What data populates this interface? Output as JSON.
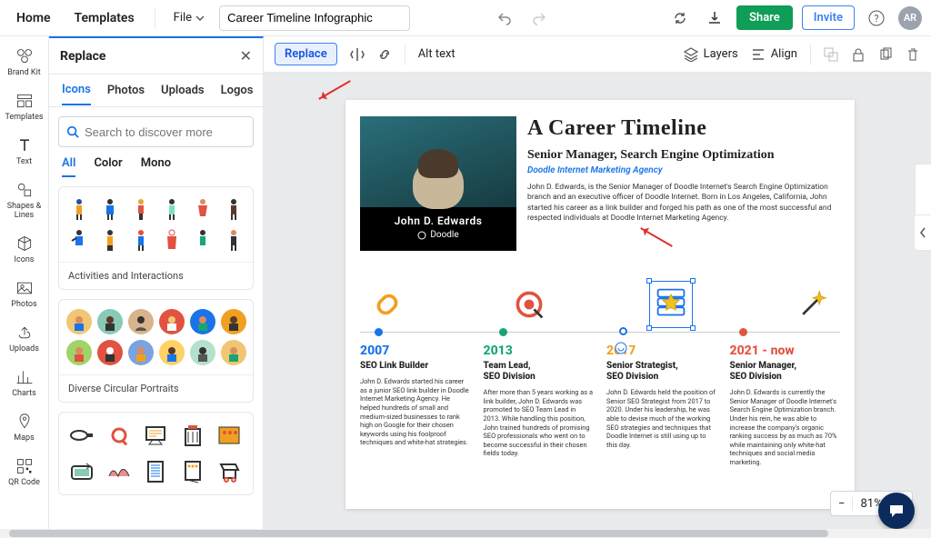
{
  "topbar": {
    "home": "Home",
    "templates": "Templates",
    "file": "File",
    "title_value": "Career Timeline Infographic",
    "share": "Share",
    "invite": "Invite",
    "avatar": "AR"
  },
  "rail": {
    "items": [
      {
        "label": "Brand Kit"
      },
      {
        "label": "Templates"
      },
      {
        "label": "Text"
      },
      {
        "label": "Shapes & Lines"
      },
      {
        "label": "Icons"
      },
      {
        "label": "Photos"
      },
      {
        "label": "Uploads"
      },
      {
        "label": "Charts"
      },
      {
        "label": "Maps"
      },
      {
        "label": "QR Code"
      }
    ]
  },
  "panel": {
    "title": "Replace",
    "tabs": [
      "Icons",
      "Photos",
      "Uploads",
      "Logos"
    ],
    "search_placeholder": "Search to discover more",
    "filters": [
      "All",
      "Color",
      "Mono"
    ],
    "card1_caption": "Activities and Interactions",
    "card2_caption": "Diverse Circular Portraits"
  },
  "ctx": {
    "replace": "Replace",
    "alt_text": "Alt text",
    "layers": "Layers",
    "align": "Align"
  },
  "doc": {
    "title": "A Career Timeline",
    "role": "Senior Manager, Search Engine Optimization",
    "agency": "Doodle Internet Marketing Agency",
    "bio": "John D. Edwards, is the Senior Manager of Doodle Internet's Search Engine Optimization branch and an executive officer of Doodle Internet. Born in Los Angeles, California, John started his career as a link builder and forged his path as one of the most successful and respected individuals at Doodle Internet Marketing Agency.",
    "profile_name": "John D. Edwards",
    "profile_company": "Doodle",
    "timeline": [
      {
        "year": "2007",
        "job": "SEO Link Builder",
        "desc": "John D. Edwards started his career as a junior SEO link builder in Doodle Internet Marketing Agency. He helped hundreds of small and medium-sized businesses to rank high on Google for their chosen keywords using his foolproof techniques and white-hat strategies."
      },
      {
        "year": "2013",
        "job": "Team Lead,\nSEO Division",
        "desc": "After more than 5 years working as a link builder, John D. Edwards was promoted to SEO Team Lead in 2013. While handling this position, John trained hundreds of promising SEO professionals who went on to become successful in their chosen fields today."
      },
      {
        "year": "2017",
        "job": "Senior Strategist,\nSEO Division",
        "desc": "John D. Edwards held the position of Senior SEO Strategist from 2017 to 2020. Under his leadership, he was able to devise much of the working SEO strategies and techniques that Doodle Internet is still using up to this day."
      },
      {
        "year": "2021 - now",
        "job": "Senior Manager,\nSEO Division",
        "desc": "John D. Edwards is currently the Senior Manager of Doodle Internet's Search Engine Optimization branch. Under his rein, he was able to increase the company's organic ranking success by as much as 70% while maintaining only white-hat techniques and social media marketing."
      }
    ]
  },
  "zoom": {
    "value": "81%"
  }
}
